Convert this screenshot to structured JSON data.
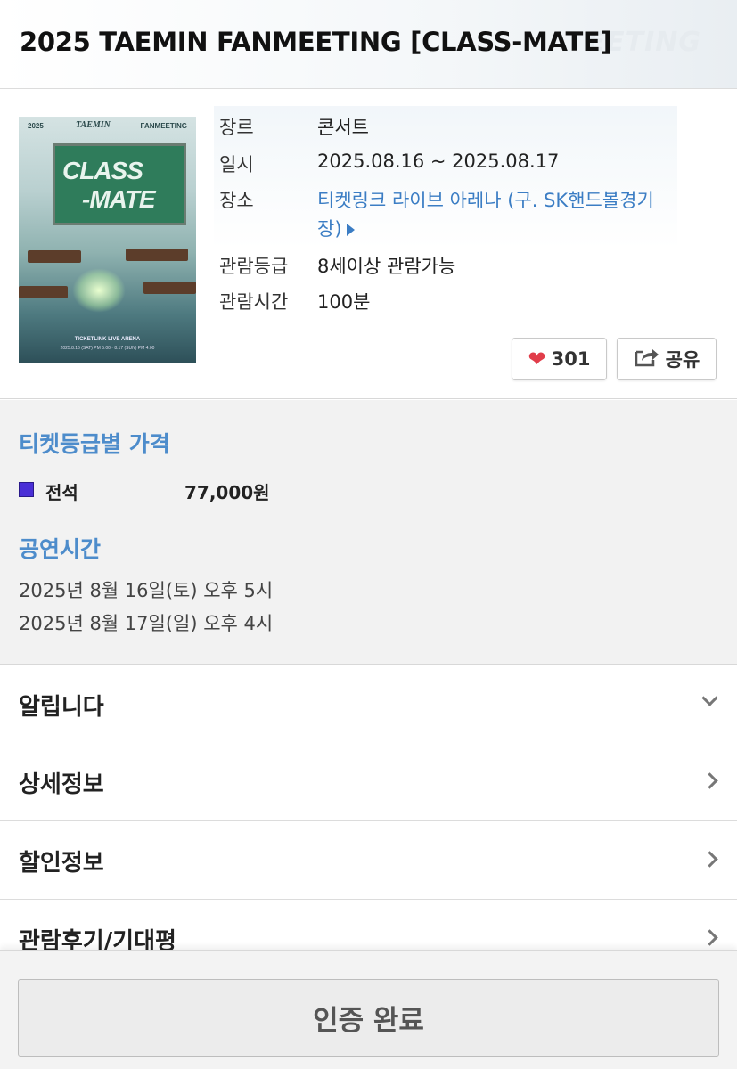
{
  "header": {
    "title": "2025 TAEMIN FANMEETING [CLASS-MATE]",
    "ghost_text": "EETING"
  },
  "poster": {
    "top_left": "2025",
    "top_mid": "TAEMIN",
    "top_right": "FANMEETING",
    "board_line1": "CLASS",
    "board_line2": "-MATE",
    "venue": "TICKETLINK LIVE ARENA",
    "dates": "2025.8.16 (SAT) PM 5:00 · 8.17 (SUN) PM 4:00"
  },
  "info": {
    "genre": {
      "label": "장르",
      "value": "콘서트"
    },
    "date": {
      "label": "일시",
      "value": "2025.08.16 ~ 2025.08.17"
    },
    "venue": {
      "label": "장소",
      "value_line1": "티켓링크 라이브 아레나 (구. SK핸드볼경기",
      "value_line2": "장)"
    },
    "rating": {
      "label": "관람등급",
      "value": "8세이상 관람가능"
    },
    "runtime": {
      "label": "관람시간",
      "value": "100분"
    }
  },
  "actions": {
    "like_count": "301",
    "share_label": "공유"
  },
  "pricing": {
    "title": "티켓등급별 가격",
    "items": [
      {
        "name": "전석",
        "price": "77,000원",
        "color": "#4a2fd6"
      }
    ]
  },
  "showtimes": {
    "title": "공연시간",
    "items": [
      "2025년 8월 16일(토) 오후 5시",
      "2025년 8월 17일(일) 오후 4시"
    ]
  },
  "sections": [
    {
      "label": "알립니다",
      "icon": "chevron-down-icon"
    },
    {
      "label": "상세정보",
      "icon": "chevron-right-icon"
    },
    {
      "label": "할인정보",
      "icon": "chevron-right-icon"
    },
    {
      "label": "관람후기/기대평",
      "icon": "chevron-right-icon"
    }
  ],
  "cta": {
    "label": "인증 완료"
  },
  "colors": {
    "accent_blue": "#4d8ccb",
    "link_blue": "#3b7dc4",
    "heart_red": "#e13d4a"
  }
}
